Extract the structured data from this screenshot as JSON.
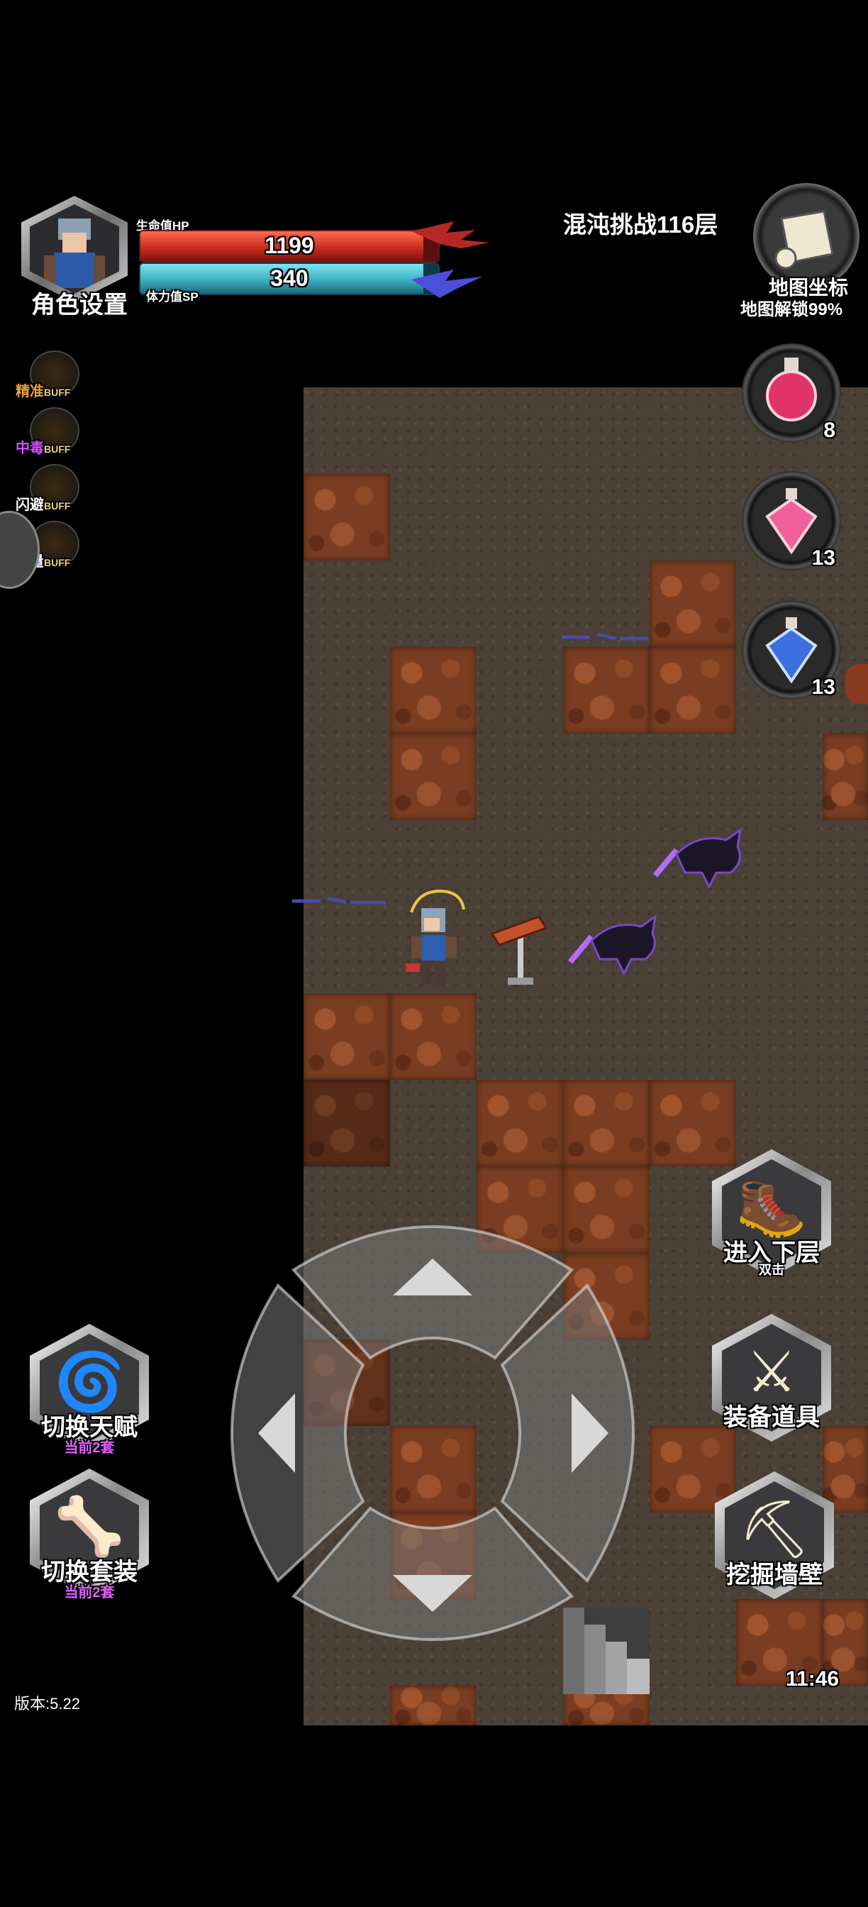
{
  "hud": {
    "avatar_label": "角色设置",
    "hp_label": "生命值HP",
    "hp_value": "1199",
    "hp_fraction": 0.95,
    "sp_label": "体力值SP",
    "sp_value": "340",
    "sp_fraction": 0.95,
    "level_title": "混沌挑战116层",
    "map_coord_label": "地图坐标",
    "map_unlock_label": "地图解锁99%"
  },
  "buffs": [
    {
      "name": "精准",
      "tag": "BUFF",
      "color": "#e8a040"
    },
    {
      "name": "中毒",
      "tag": "BUFF",
      "color": "#d050ff"
    },
    {
      "name": "闪避",
      "tag": "BUFF",
      "color": "#ffffff"
    },
    {
      "name": "力量",
      "tag": "BUFF",
      "color": "#ffffff"
    }
  ],
  "potions": [
    {
      "icon": "red-health-potion-icon",
      "count": "8"
    },
    {
      "icon": "pink-crystal-potion-icon",
      "count": "13"
    },
    {
      "icon": "blue-crystal-potion-icon",
      "count": "13"
    }
  ],
  "right_buttons": [
    {
      "label": "进入下层",
      "sub": "双击",
      "icon": "boot-icon"
    },
    {
      "label": "装备道具",
      "sub": "",
      "icon": "sword-icon"
    },
    {
      "label": "挖掘墙壁",
      "sub": "",
      "icon": "pickaxe-icon"
    }
  ],
  "left_buttons": [
    {
      "label": "切换天赋",
      "sub": "当前2套",
      "icon": "vortex-icon"
    },
    {
      "label": "切换套装",
      "sub": "当前2套",
      "icon": "bone-weapon-icon"
    }
  ],
  "clock": "11:46",
  "version": "版本:5.22",
  "colors": {
    "hp": "#d83a2a",
    "sp": "#3fb2c4",
    "talent_sub": "#e060ff"
  }
}
